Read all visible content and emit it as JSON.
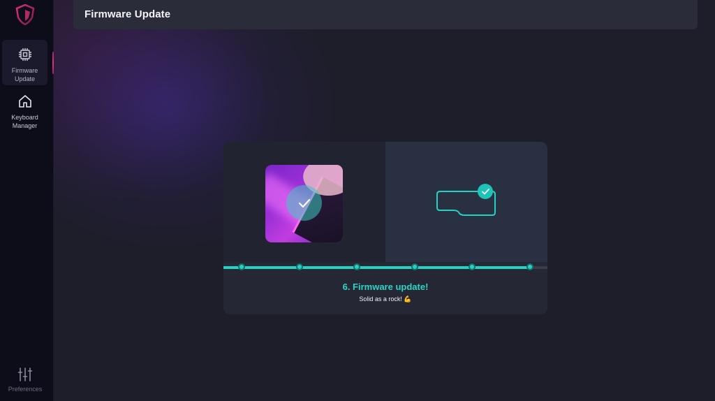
{
  "sidebar": {
    "logo": "shield-logo",
    "items": [
      {
        "label": "Firmware Update",
        "icon": "chip-icon",
        "active": true
      },
      {
        "label": "Keyboard Manager",
        "icon": "home-icon",
        "active": false
      }
    ],
    "preferences": {
      "label": "Preferences",
      "icon": "sliders-icon"
    }
  },
  "header": {
    "title": "Firmware Update"
  },
  "update": {
    "step_title": "6. Firmware update!",
    "step_subtitle": "Solid as a rock! 💪",
    "progress_fraction": 0.945,
    "steps_total": 6,
    "steps_done": 6
  },
  "colors": {
    "accent": "#22d3c5",
    "sidebar_bg": "#0d0c19",
    "card_bg": "#252735",
    "brand": "#e0307e"
  }
}
